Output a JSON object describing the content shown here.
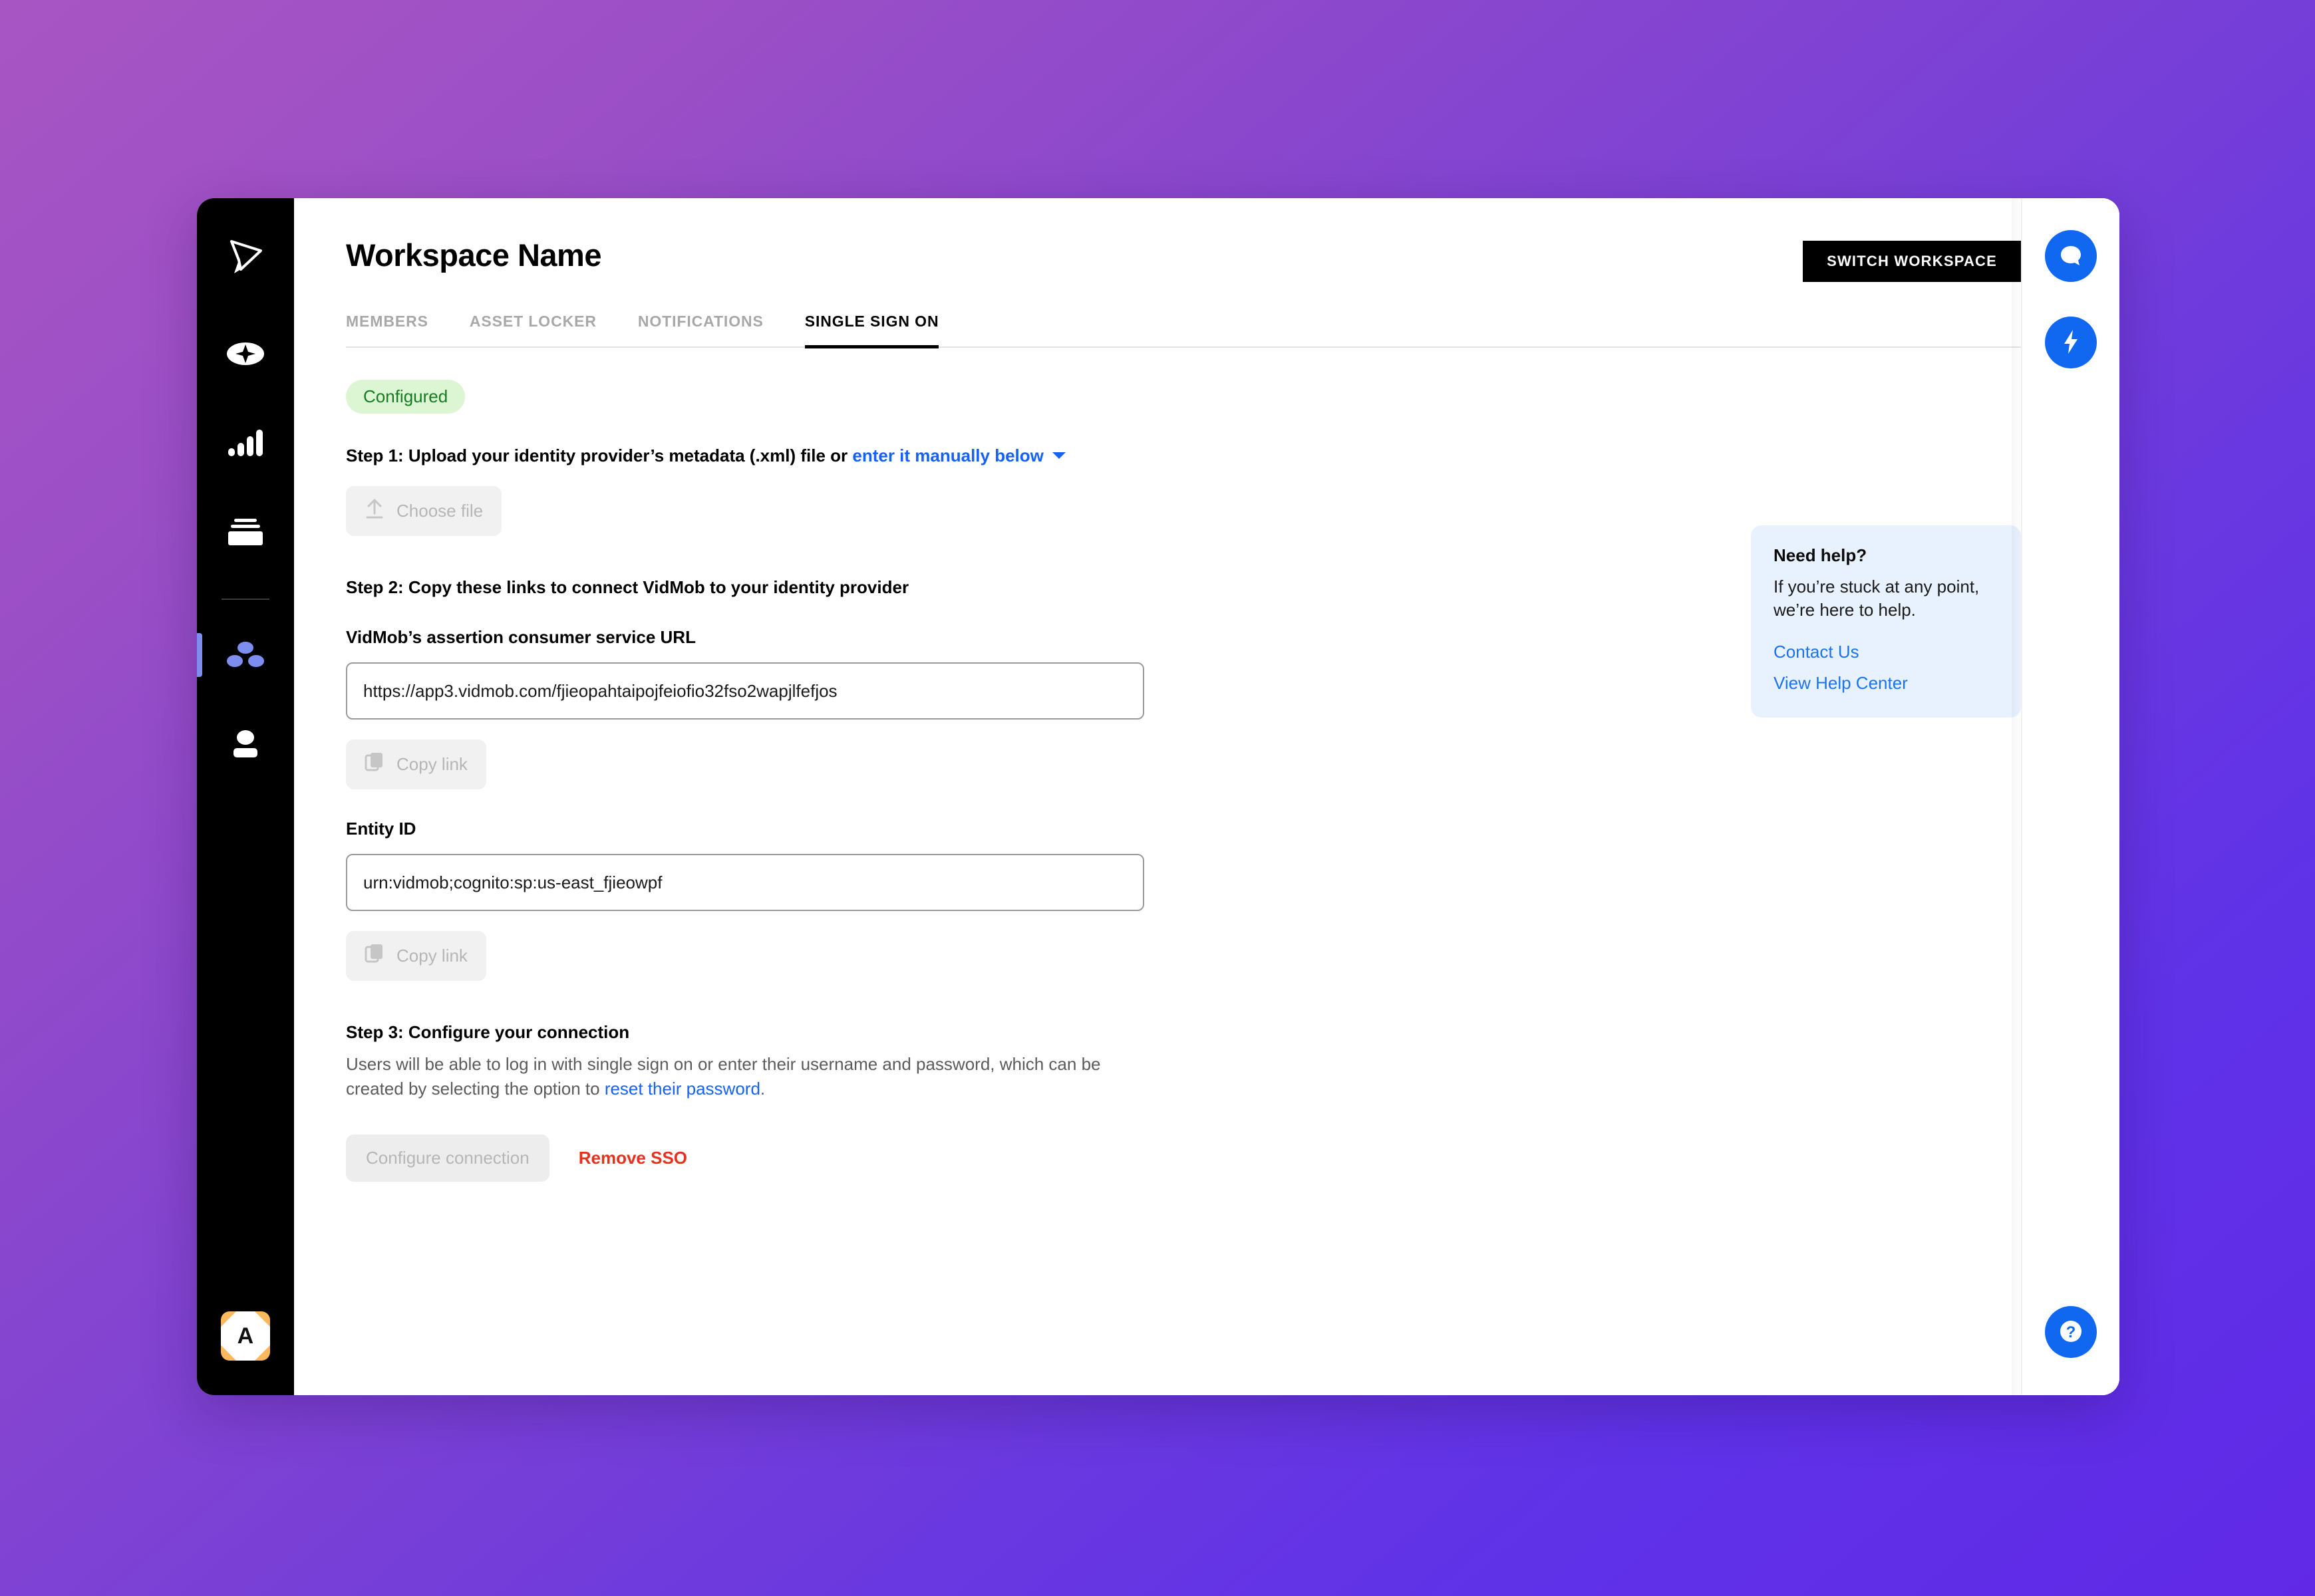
{
  "window": {
    "title": "Workspace Name"
  },
  "sidebar": {
    "items": [
      {
        "name": "vidmob-logo",
        "icon": "vidmob-logo-icon"
      },
      {
        "name": "create",
        "icon": "sparkle-icon"
      },
      {
        "name": "analytics",
        "icon": "bar-chart-icon"
      },
      {
        "name": "library",
        "icon": "stack-icon"
      },
      {
        "name": "workspace-settings",
        "icon": "three-dots-icon",
        "active": true
      },
      {
        "name": "people",
        "icon": "person-icon"
      }
    ],
    "avatar_initial": "A"
  },
  "header": {
    "title": "Workspace Name",
    "switch_workspace_label": "SWITCH WORKSPACE"
  },
  "tabs": [
    {
      "label": "MEMBERS",
      "active": false
    },
    {
      "label": "ASSET LOCKER",
      "active": false
    },
    {
      "label": "NOTIFICATIONS",
      "active": false
    },
    {
      "label": "SINGLE SIGN ON",
      "active": true
    }
  ],
  "sso": {
    "status_badge": "Configured",
    "step1": {
      "heading_before_link": "Step 1: Upload your identity provider’s metadata (.xml) file or ",
      "link_label": "enter it manually below",
      "choose_file_label": "Choose file",
      "upload_icon": "upload-arrow-icon",
      "caret_icon": "chevron-down-icon"
    },
    "step2": {
      "heading": "Step 2: Copy these links to connect VidMob to your identity provider",
      "acs_label": "VidMob’s assertion consumer service URL",
      "acs_value": "https://app3.vidmob.com/fjieopahtaipojfeiofio32fso2wapjlfefjos",
      "acs_copy_label": "Copy link",
      "entity_label": "Entity ID",
      "entity_value": "urn:vidmob;cognito:sp:us-east_fjieowpf",
      "entity_copy_label": "Copy link",
      "copy_icon": "copy-icon"
    },
    "step3": {
      "heading": "Step 3: Configure your connection",
      "body_before_link": "Users will be able to log in with single sign on or enter their username and password, which can be created by selecting the option to ",
      "link_label": "reset their password",
      "body_after_link": ".",
      "configure_label": "Configure connection",
      "remove_label": "Remove SSO"
    }
  },
  "help_card": {
    "title": "Need help?",
    "body": "If you’re stuck at any point, we’re here to help.",
    "contact_label": "Contact Us",
    "help_center_label": "View Help Center"
  },
  "action_rail": {
    "chat_icon": "chat-bubble-icon",
    "bolt_icon": "lightning-bolt-icon",
    "help_icon": "question-mark-icon"
  },
  "colors": {
    "accent_blue": "#1068f0",
    "link_blue": "#1662f5",
    "danger_red": "#e5321f",
    "badge_bg": "#dcf5d3",
    "badge_text": "#167a22",
    "help_card_bg": "#e8f1fe",
    "sidebar_bg": "#000000",
    "active_indicator": "#7e8ef0",
    "avatar_bg": "#f9b95c"
  }
}
